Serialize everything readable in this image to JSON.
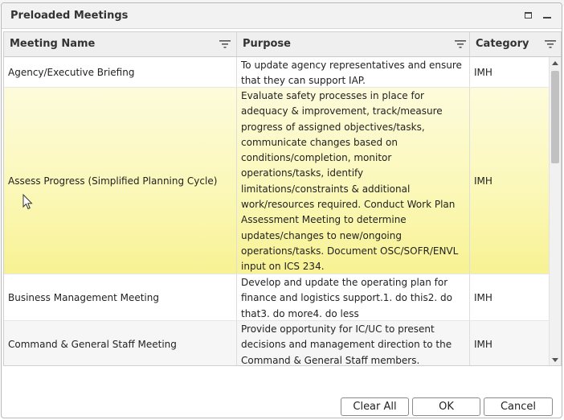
{
  "dialog": {
    "title": "Preloaded Meetings"
  },
  "icons": {
    "maximize": "maximize-icon",
    "minimize": "minimize-icon",
    "filter": "filter-icon"
  },
  "grid": {
    "columns": [
      {
        "label": "Meeting Name"
      },
      {
        "label": "Purpose"
      },
      {
        "label": "Category"
      }
    ],
    "rows": [
      {
        "name": "Agency/Executive Briefing",
        "purpose": "To update agency representatives and ensure that they can support IAP.",
        "category": "IMH"
      },
      {
        "name": "Assess Progress (Simplified Planning Cycle)",
        "purpose": "Evaluate safety processes in place for adequacy & improvement, track/measure progress of assigned objectives/tasks, communicate changes based on conditions/completion, monitor operations/tasks, identify limitations/constraints & additional work/resources required. Conduct Work Plan Assessment Meeting to determine updates/changes to new/ongoing operations/tasks. Document OSC/SOFR/ENVL input on ICS 234.",
        "category": "IMH"
      },
      {
        "name": "Business Management Meeting",
        "purpose": "Develop and update the operating plan for finance and logistics support.1. do this2. do that3. do more4. do less",
        "category": "IMH"
      },
      {
        "name": "Command & General Staff Meeting",
        "purpose": "Provide opportunity for IC/UC to present decisions and management direction to the Command & General Staff members.",
        "category": "IMH"
      }
    ]
  },
  "buttons": {
    "clear_all": "Clear All",
    "ok": "OK",
    "cancel": "Cancel"
  },
  "colors": {
    "selected_row_top": "#fdfbdb",
    "selected_row_bottom": "#f8f293",
    "header_bg": "#efefef"
  }
}
